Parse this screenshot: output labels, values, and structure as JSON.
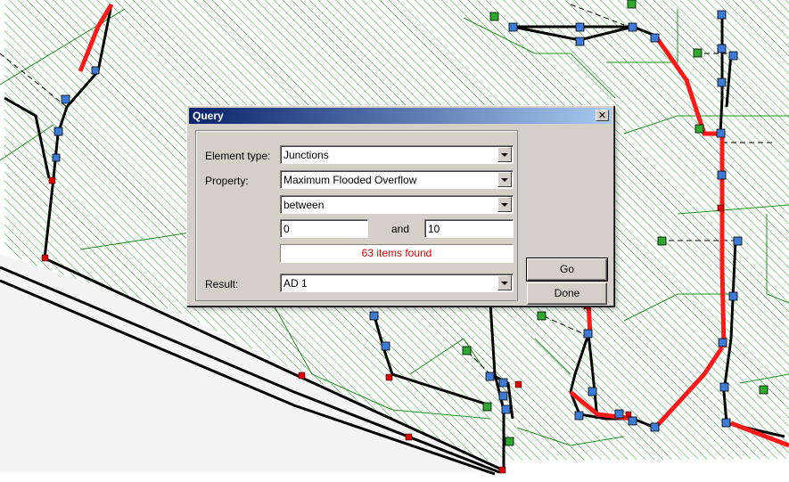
{
  "dialog": {
    "title": "Query",
    "close_glyph": "✕",
    "element_type_label": "Element type:",
    "element_type_value": "Junctions",
    "property_label": "Property:",
    "property_value": "Maximum Flooded Overflow",
    "condition_value": "between",
    "lower_value": "0",
    "and_label": "and",
    "upper_value": "10",
    "status_text": "63 items found",
    "result_label": "Result:",
    "result_value": "AD 1",
    "go_label": "Go",
    "done_label": "Done"
  },
  "colors": {
    "hatch": "#2e9e2e",
    "conduit": "#000000",
    "highlight": "#ff1a1a",
    "junction": "#3d7bd6",
    "node": "#e00000",
    "subcatchment": "#1f8f1f",
    "status_text": "#e00000"
  }
}
